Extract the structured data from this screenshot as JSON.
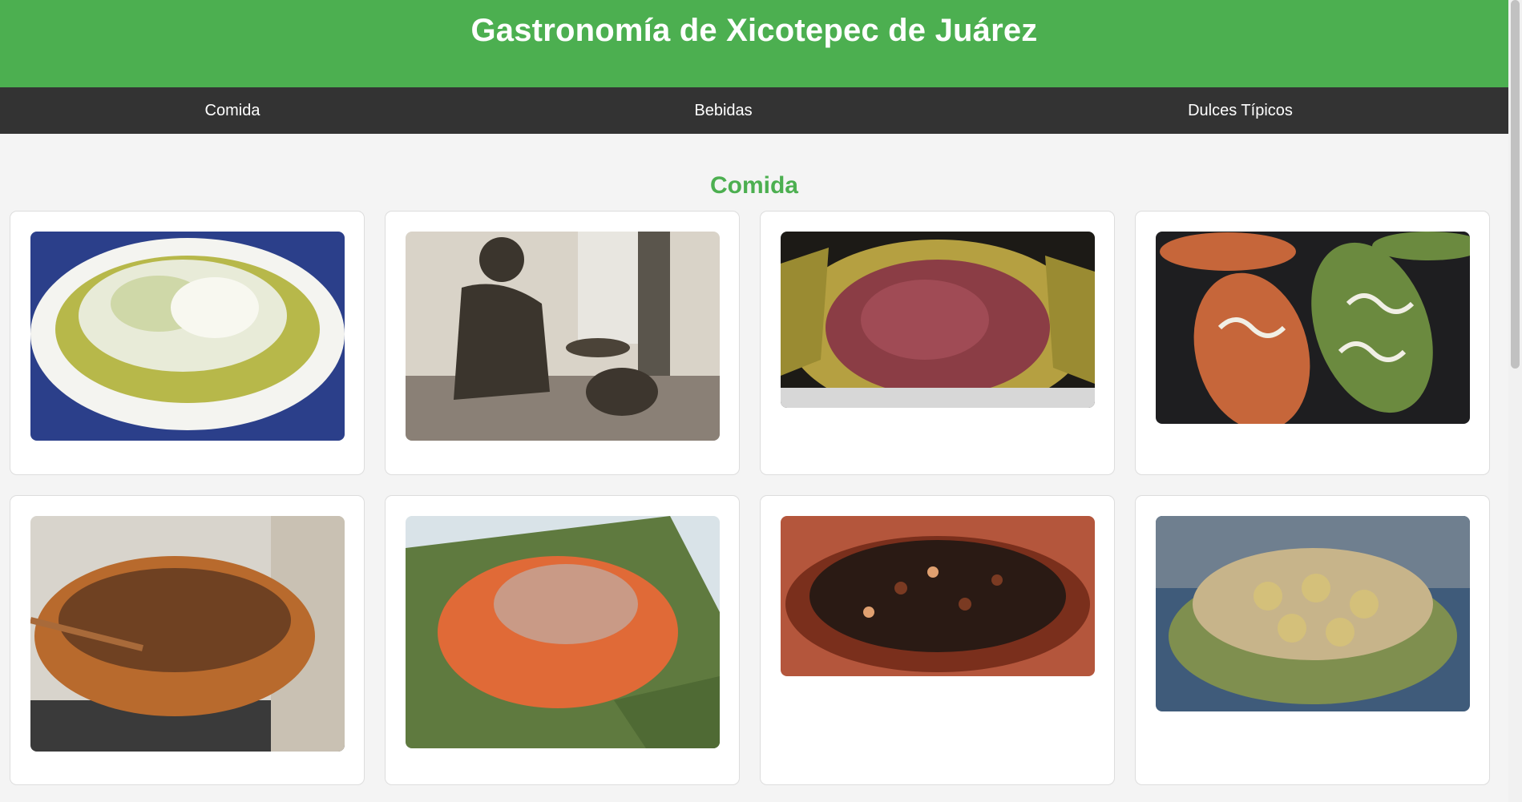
{
  "header": {
    "title": "Gastronomía de Xicotepec de Juárez"
  },
  "nav": {
    "items": [
      "Comida",
      "Bebidas",
      "Dulces Típicos"
    ]
  },
  "section": {
    "title": "Comida"
  },
  "cards": [
    {
      "image": "enchiladas-verdes-plate",
      "palette": [
        "#2b3f8a",
        "#f4f4f0",
        "#b7b84a",
        "#e8ebd8"
      ]
    },
    {
      "image": "bronze-statue-vendor",
      "palette": [
        "#d9d3c8",
        "#3b352d",
        "#8a8076",
        "#e8e6e0"
      ]
    },
    {
      "image": "meat-in-banana-leaves",
      "palette": [
        "#1c1a16",
        "#8b3d45",
        "#b5a041",
        "#d7d7d7"
      ]
    },
    {
      "image": "tlacoyos-with-salsa",
      "palette": [
        "#1e1e20",
        "#c6663a",
        "#6b8a3f",
        "#f1efe5"
      ]
    },
    {
      "image": "clay-pot-soup",
      "palette": [
        "#d8d4cc",
        "#b86a2d",
        "#6f4122",
        "#3a3a3a"
      ]
    },
    {
      "image": "rice-and-shredded-meat",
      "palette": [
        "#5f7a3f",
        "#e06a37",
        "#c99a86",
        "#d9e3e8"
      ]
    },
    {
      "image": "fried-ants-plate",
      "palette": [
        "#b4563c",
        "#2a1a14",
        "#7a2f1c",
        "#e0a070"
      ]
    },
    {
      "image": "bread-rolls-basket",
      "palette": [
        "#3f5b7a",
        "#c7b48a",
        "#7f8f4f",
        "#d4c07a"
      ]
    }
  ]
}
